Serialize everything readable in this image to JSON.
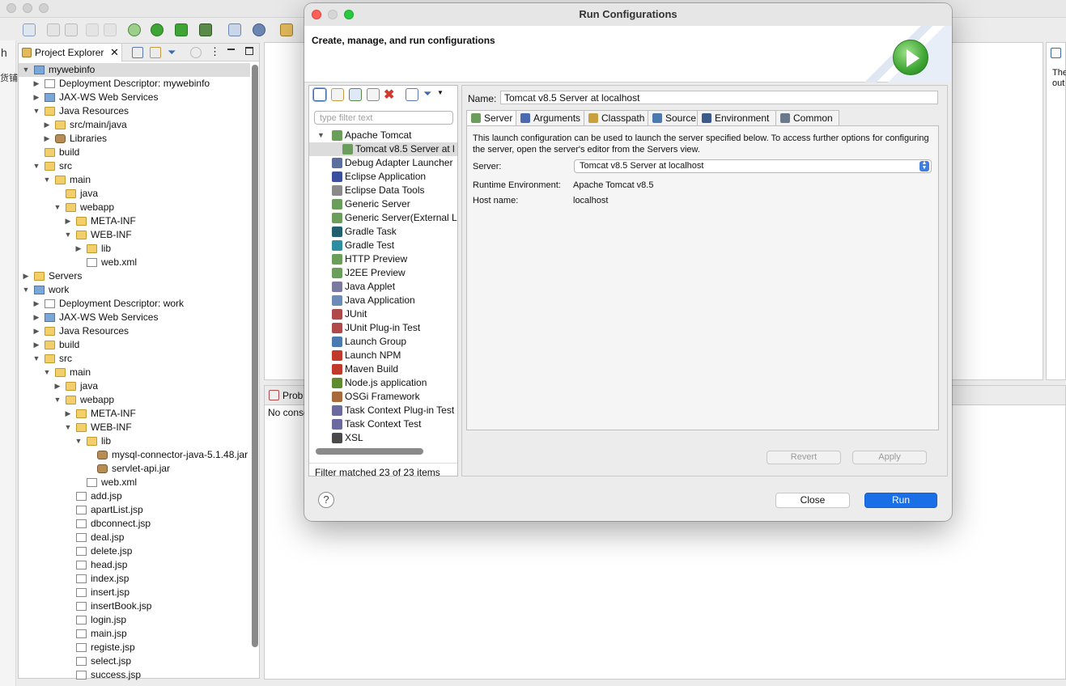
{
  "ide": {
    "project_explorer_tab": "Project Explorer",
    "tree": [
      {
        "label": "mywebinfo",
        "depth": 0,
        "arrow": "down",
        "icon": "proj"
      },
      {
        "label": "Deployment Descriptor: mywebinfo",
        "depth": 1,
        "arrow": "right",
        "icon": "file"
      },
      {
        "label": "JAX-WS Web Services",
        "depth": 1,
        "arrow": "right",
        "icon": "proj"
      },
      {
        "label": "Java Resources",
        "depth": 1,
        "arrow": "down",
        "icon": "fold"
      },
      {
        "label": "src/main/java",
        "depth": 2,
        "arrow": "right",
        "icon": "fold"
      },
      {
        "label": "Libraries",
        "depth": 2,
        "arrow": "right",
        "icon": "jar"
      },
      {
        "label": "build",
        "depth": 1,
        "arrow": "",
        "icon": "fold"
      },
      {
        "label": "src",
        "depth": 1,
        "arrow": "down",
        "icon": "fold"
      },
      {
        "label": "main",
        "depth": 2,
        "arrow": "down",
        "icon": "fold"
      },
      {
        "label": "java",
        "depth": 3,
        "arrow": "",
        "icon": "fold"
      },
      {
        "label": "webapp",
        "depth": 3,
        "arrow": "down",
        "icon": "fold"
      },
      {
        "label": "META-INF",
        "depth": 4,
        "arrow": "right",
        "icon": "fold"
      },
      {
        "label": "WEB-INF",
        "depth": 4,
        "arrow": "down",
        "icon": "fold"
      },
      {
        "label": "lib",
        "depth": 5,
        "arrow": "right",
        "icon": "fold"
      },
      {
        "label": "web.xml",
        "depth": 5,
        "arrow": "",
        "icon": "file"
      },
      {
        "label": "Servers",
        "depth": 0,
        "arrow": "right",
        "icon": "fold"
      },
      {
        "label": "work",
        "depth": 0,
        "arrow": "down",
        "icon": "proj"
      },
      {
        "label": "Deployment Descriptor: work",
        "depth": 1,
        "arrow": "right",
        "icon": "file"
      },
      {
        "label": "JAX-WS Web Services",
        "depth": 1,
        "arrow": "right",
        "icon": "proj"
      },
      {
        "label": "Java Resources",
        "depth": 1,
        "arrow": "right",
        "icon": "fold"
      },
      {
        "label": "build",
        "depth": 1,
        "arrow": "right",
        "icon": "fold"
      },
      {
        "label": "src",
        "depth": 1,
        "arrow": "down",
        "icon": "fold"
      },
      {
        "label": "main",
        "depth": 2,
        "arrow": "down",
        "icon": "fold"
      },
      {
        "label": "java",
        "depth": 3,
        "arrow": "right",
        "icon": "fold"
      },
      {
        "label": "webapp",
        "depth": 3,
        "arrow": "down",
        "icon": "fold"
      },
      {
        "label": "META-INF",
        "depth": 4,
        "arrow": "right",
        "icon": "fold"
      },
      {
        "label": "WEB-INF",
        "depth": 4,
        "arrow": "down",
        "icon": "fold"
      },
      {
        "label": "lib",
        "depth": 5,
        "arrow": "down",
        "icon": "fold"
      },
      {
        "label": "mysql-connector-java-5.1.48.jar",
        "depth": 6,
        "arrow": "",
        "icon": "jar"
      },
      {
        "label": "servlet-api.jar",
        "depth": 6,
        "arrow": "",
        "icon": "jar"
      },
      {
        "label": "web.xml",
        "depth": 5,
        "arrow": "",
        "icon": "file"
      },
      {
        "label": "add.jsp",
        "depth": 4,
        "arrow": "",
        "icon": "file"
      },
      {
        "label": "apartList.jsp",
        "depth": 4,
        "arrow": "",
        "icon": "file"
      },
      {
        "label": "dbconnect.jsp",
        "depth": 4,
        "arrow": "",
        "icon": "file"
      },
      {
        "label": "deal.jsp",
        "depth": 4,
        "arrow": "",
        "icon": "file"
      },
      {
        "label": "delete.jsp",
        "depth": 4,
        "arrow": "",
        "icon": "file"
      },
      {
        "label": "head.jsp",
        "depth": 4,
        "arrow": "",
        "icon": "file"
      },
      {
        "label": "index.jsp",
        "depth": 4,
        "arrow": "",
        "icon": "file"
      },
      {
        "label": "insert.jsp",
        "depth": 4,
        "arrow": "",
        "icon": "file"
      },
      {
        "label": "insertBook.jsp",
        "depth": 4,
        "arrow": "",
        "icon": "file"
      },
      {
        "label": "login.jsp",
        "depth": 4,
        "arrow": "",
        "icon": "file"
      },
      {
        "label": "main.jsp",
        "depth": 4,
        "arrow": "",
        "icon": "file"
      },
      {
        "label": "registe.jsp",
        "depth": 4,
        "arrow": "",
        "icon": "file"
      },
      {
        "label": "select.jsp",
        "depth": 4,
        "arrow": "",
        "icon": "file"
      },
      {
        "label": "success.jsp",
        "depth": 4,
        "arrow": "",
        "icon": "file"
      }
    ],
    "bottom_tab": "Prob",
    "bottom_msg": "No consc",
    "right_text_1": "The",
    "right_text_2": "out",
    "left_trunc_1": "h",
    "left_trunc_2": "货铺"
  },
  "dialog": {
    "title": "Run Configurations",
    "banner_heading": "Create, manage, and run configurations",
    "filter_placeholder": "type filter text",
    "config_types": [
      {
        "label": "Apache Tomcat",
        "child": false,
        "arrow": "down",
        "color": "#6a9e5a"
      },
      {
        "label": "Tomcat v8.5 Server at l",
        "child": true,
        "arrow": "",
        "color": "#6a9e5a",
        "selected": true
      },
      {
        "label": "Debug Adapter Launcher",
        "child": false,
        "arrow": "",
        "color": "#5b6e9e"
      },
      {
        "label": "Eclipse Application",
        "child": false,
        "arrow": "",
        "color": "#3a4f9e"
      },
      {
        "label": "Eclipse Data Tools",
        "child": false,
        "arrow": "",
        "color": "#8a8a8a"
      },
      {
        "label": "Generic Server",
        "child": false,
        "arrow": "",
        "color": "#6a9e5a"
      },
      {
        "label": "Generic Server(External L",
        "child": false,
        "arrow": "",
        "color": "#6a9e5a"
      },
      {
        "label": "Gradle Task",
        "child": false,
        "arrow": "",
        "color": "#1f5f6e"
      },
      {
        "label": "Gradle Test",
        "child": false,
        "arrow": "",
        "color": "#2c8ea0"
      },
      {
        "label": "HTTP Preview",
        "child": false,
        "arrow": "",
        "color": "#6a9e5a"
      },
      {
        "label": "J2EE Preview",
        "child": false,
        "arrow": "",
        "color": "#6a9e5a"
      },
      {
        "label": "Java Applet",
        "child": false,
        "arrow": "",
        "color": "#7a7a9e"
      },
      {
        "label": "Java Application",
        "child": false,
        "arrow": "",
        "color": "#6c8bb8"
      },
      {
        "label": "JUnit",
        "child": false,
        "arrow": "",
        "color": "#b04a4a"
      },
      {
        "label": "JUnit Plug-in Test",
        "child": false,
        "arrow": "",
        "color": "#b04a4a"
      },
      {
        "label": "Launch Group",
        "child": false,
        "arrow": "",
        "color": "#4a7ab0"
      },
      {
        "label": "Launch NPM",
        "child": false,
        "arrow": "",
        "color": "#c0392b"
      },
      {
        "label": "Maven Build",
        "child": false,
        "arrow": "",
        "color": "#c0392b"
      },
      {
        "label": "Node.js application",
        "child": false,
        "arrow": "",
        "color": "#5f8a2e"
      },
      {
        "label": "OSGi Framework",
        "child": false,
        "arrow": "",
        "color": "#a86a3a"
      },
      {
        "label": "Task Context Plug-in Test",
        "child": false,
        "arrow": "",
        "color": "#6a6a9e"
      },
      {
        "label": "Task Context Test",
        "child": false,
        "arrow": "",
        "color": "#6a6a9e"
      },
      {
        "label": "XSL",
        "child": false,
        "arrow": "",
        "color": "#4a4a4a"
      }
    ],
    "filter_status": "Filter matched 23 of 23 items",
    "name_label": "Name:",
    "name_value": "Tomcat v8.5 Server at localhost",
    "tabs": [
      {
        "label": "Server",
        "active": true,
        "color": "#6a9e5a"
      },
      {
        "label": "Arguments",
        "active": false,
        "color": "#4a6ab0"
      },
      {
        "label": "Classpath",
        "active": false,
        "color": "#c8a040"
      },
      {
        "label": "Source",
        "active": false,
        "color": "#4a7ab0"
      },
      {
        "label": "Environment",
        "active": false,
        "color": "#3a5a8a"
      },
      {
        "label": "Common",
        "active": false,
        "color": "#6a7a8a"
      }
    ],
    "server_tab": {
      "description": "This launch configuration can be used to launch the server specified below. To access further options for configuring the server, open the server's editor from the Servers view.",
      "server_label": "Server:",
      "server_value": "Tomcat v8.5 Server at localhost",
      "runtime_label": "Runtime Environment:",
      "runtime_value": "Apache Tomcat v8.5",
      "host_label": "Host name:",
      "host_value": "localhost"
    },
    "revert_label": "Revert",
    "apply_label": "Apply",
    "help_label": "?",
    "close_label": "Close",
    "run_label": "Run"
  }
}
